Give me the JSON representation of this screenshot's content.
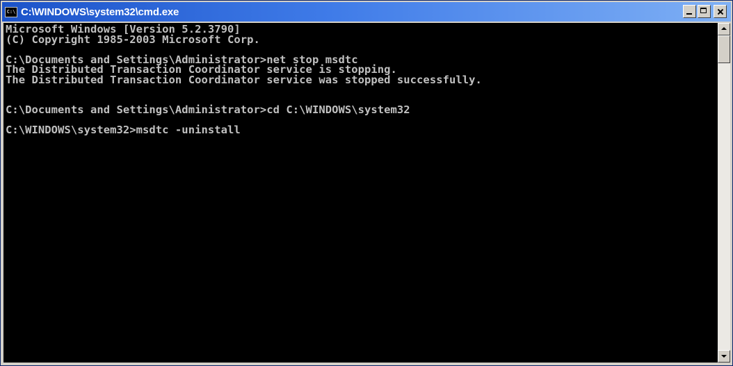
{
  "window": {
    "title": "C:\\WINDOWS\\system32\\cmd.exe",
    "icon_text": "C:\\",
    "icons": {
      "app": "console-icon",
      "minimize": "minimize-icon",
      "maximize": "maximize-icon",
      "close": "close-icon"
    },
    "colors": {
      "titlebar_start": "#1c53c9",
      "titlebar_end": "#7fb0f5",
      "console_background": "#000000",
      "console_text": "#c0c0c0"
    }
  },
  "console": {
    "lines": [
      "Microsoft Windows [Version 5.2.3790]",
      "(C) Copyright 1985-2003 Microsoft Corp.",
      "",
      "C:\\Documents and Settings\\Administrator>net stop msdtc",
      "The Distributed Transaction Coordinator service is stopping.",
      "The Distributed Transaction Coordinator service was stopped successfully.",
      "",
      "",
      "C:\\Documents and Settings\\Administrator>cd C:\\WINDOWS\\system32",
      "",
      "C:\\WINDOWS\\system32>msdtc -uninstall"
    ]
  },
  "scrollbar": {
    "up_icon": "scroll-up-arrow-icon",
    "down_icon": "scroll-down-arrow-icon"
  }
}
